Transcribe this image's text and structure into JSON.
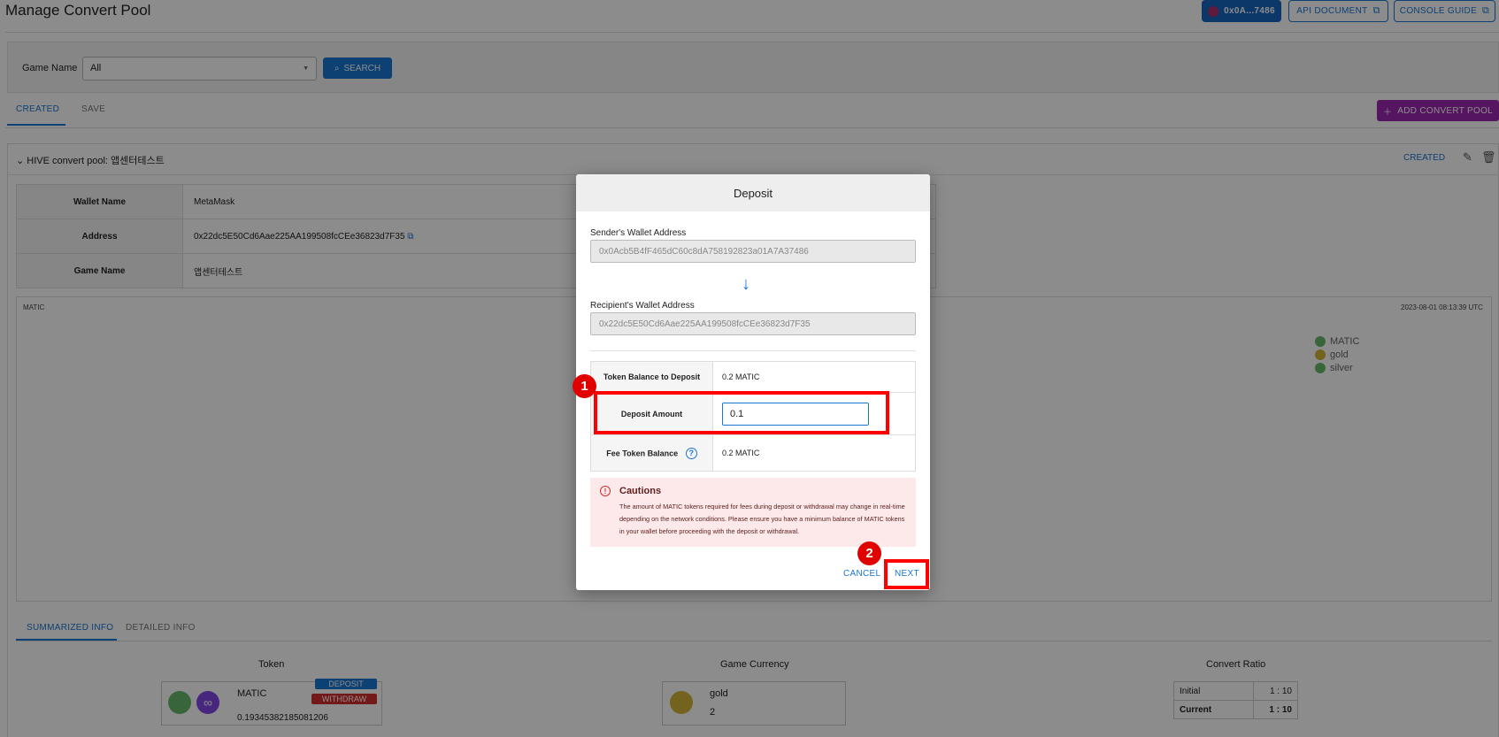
{
  "header": {
    "title": "Manage Convert Pool",
    "wallet_label": "0x0A...7486",
    "api_doc_label": "API DOCUMENT",
    "console_guide_label": "CONSOLE GUIDE"
  },
  "search": {
    "game_name_label": "Game Name",
    "game_name_value": "All",
    "search_label": "SEARCH"
  },
  "tabs": [
    {
      "label": "CREATED",
      "active": true
    },
    {
      "label": "SAVE",
      "active": false
    }
  ],
  "add_pool_label": "ADD CONVERT POOL",
  "pool": {
    "title": "HIVE convert pool: 앱센터테스트",
    "status": "CREATED",
    "info": [
      {
        "key": "Wallet Name",
        "value": "MetaMask"
      },
      {
        "key": "Address",
        "value": "0x22dc5E50Cd6Aae225AA199508fcCEe36823d7F35"
      },
      {
        "key": "Game Name",
        "value": "앱센터테스트"
      }
    ],
    "chart_title": "MATIC",
    "chart_date": "2023-08-01 08:13:39 UTC",
    "legend": [
      {
        "name": "MATIC",
        "color": "#66bb6a"
      },
      {
        "name": "gold",
        "color": "#d4b43a"
      },
      {
        "name": "silver",
        "color": "#66bb6a"
      }
    ],
    "sub_tabs": [
      {
        "label": "SUMMARIZED INFO",
        "active": true
      },
      {
        "label": "DETAILED INFO",
        "active": false
      }
    ],
    "summary": {
      "token_header": "Token",
      "game_currency_header": "Game Currency",
      "convert_ratio_header": "Convert Ratio",
      "token_name": "MATIC",
      "token_balance": "0.19345382185081206",
      "deposit_label": "DEPOSIT",
      "withdraw_label": "WITHDRAW",
      "currency_name": "gold",
      "currency_amount": "2",
      "ratio_rows": [
        {
          "label": "Initial",
          "value": "1 : 10"
        },
        {
          "label": "Current",
          "value": "1 : 10"
        }
      ]
    }
  },
  "modal": {
    "title": "Deposit",
    "sender_label": "Sender's Wallet Address",
    "sender_address": "0x0Acb5B4fF465dC60c8dA758192823a01A7A37486",
    "recipient_label": "Recipient's Wallet Address",
    "recipient_address": "0x22dc5E50Cd6Aae225AA199508fcCEe36823d7F35",
    "rows": {
      "balance_label": "Token Balance to Deposit",
      "balance_value": "0.2 MATIC",
      "amount_label": "Deposit Amount",
      "amount_value": "0.1",
      "fee_label": "Fee Token Balance",
      "fee_value": "0.2 MATIC"
    },
    "caution_title": "Cautions",
    "caution_text": "The amount of MATIC tokens required for fees during deposit or withdrawal may change in real-time depending on the network conditions. Please ensure you have a minimum balance of MATIC tokens in your wallet before proceeding with the deposit or withdrawal.",
    "cancel_label": "CANCEL",
    "next_label": "NEXT"
  },
  "annotations": {
    "badge_1": "1",
    "badge_2": "2",
    "highlight_color": "#ff0000"
  }
}
